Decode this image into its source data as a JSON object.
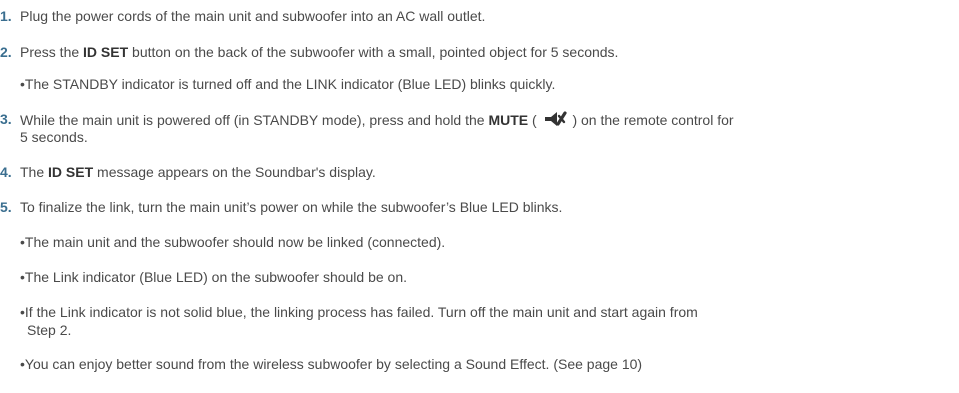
{
  "steps": [
    {
      "num": "1.",
      "text": "Plug the power cords of the main unit and subwoofer into an AC wall outlet."
    },
    {
      "num": "2.",
      "pre": "Press the ",
      "bold": "ID SET",
      "post": " button on the back of the subwoofer with a small, pointed object for 5 seconds.",
      "bullets": [
        "The STANDBY indicator is turned off and the LINK indicator (Blue LED) blinks quickly."
      ]
    },
    {
      "num": "3.",
      "pre": "While the main unit is powered off (in STANDBY mode), press and hold the ",
      "bold": "MUTE",
      "open": " ( ",
      "close": " ) on the remote control for",
      "cont": "5 seconds.",
      "icon": "mute-icon"
    },
    {
      "num": "4.",
      "pre": "The ",
      "bold": "ID SET",
      "post": " message appears on the Soundbar's display."
    },
    {
      "num": "5.",
      "text": "To finalize the link, turn the main unit’s power on while the subwoofer’s Blue LED blinks.",
      "bullets": [
        "The main unit and the subwoofer should now be linked (connected).",
        "The Link indicator (Blue LED) on the subwoofer should be on.",
        "If the Link indicator is not solid blue, the linking process has failed. Turn off the main unit and start again from",
        "You can enjoy better sound from the wireless subwoofer by selecting a Sound Effect. (See page 10)"
      ],
      "bullet3_cont": "Step 2."
    }
  ],
  "bullet_char": "•",
  "colors": {
    "number": "#3a6e8f",
    "text": "#4a4a4a",
    "bold": "#333333"
  }
}
